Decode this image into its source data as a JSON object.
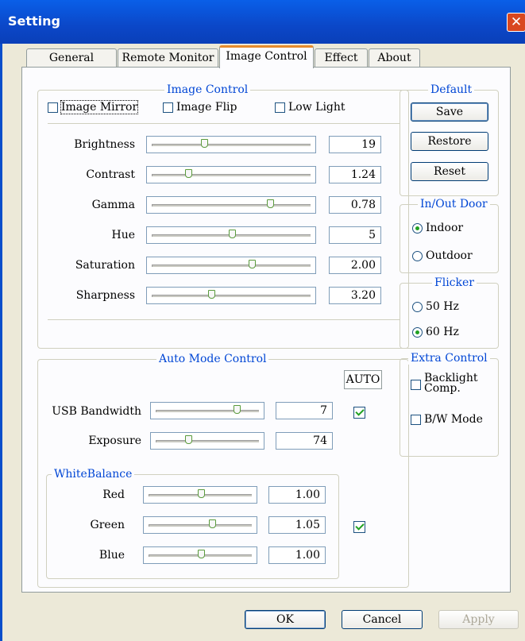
{
  "window": {
    "title": "Setting",
    "close_glyph": "✕"
  },
  "tabs": [
    "General Setting",
    "Remote Monitor",
    "Image Control",
    "Effect",
    "About"
  ],
  "image_control": {
    "title": "Image Control",
    "checkboxes": [
      "Image Mirror",
      "Image Flip",
      "Low Light"
    ],
    "sliders": [
      {
        "label": "Brightness",
        "value": "19",
        "position": 0.32
      },
      {
        "label": "Contrast",
        "value": "1.24",
        "position": 0.22
      },
      {
        "label": "Gamma",
        "value": "0.78",
        "position": 0.75
      },
      {
        "label": "Hue",
        "value": "5",
        "position": 0.5
      },
      {
        "label": "Saturation",
        "value": "2.00",
        "position": 0.63
      },
      {
        "label": "Sharpness",
        "value": "3.20",
        "position": 0.37
      }
    ]
  },
  "auto_mode": {
    "title": "Auto Mode Control",
    "auto_label": "AUTO",
    "usb_bandwidth": {
      "label": "USB Bandwidth",
      "value": "7",
      "position": 0.8,
      "auto_checked": true
    },
    "exposure": {
      "label": "Exposure",
      "value": "74",
      "position": 0.3
    },
    "whitebalance": {
      "title": "WhiteBalance",
      "auto_checked": true,
      "channels": [
        {
          "label": "Red",
          "value": "1.00",
          "position": 0.5
        },
        {
          "label": "Green",
          "value": "1.05",
          "position": 0.62
        },
        {
          "label": "Blue",
          "value": "1.00",
          "position": 0.5
        }
      ]
    }
  },
  "default_group": {
    "title": "Default",
    "buttons": [
      "Save",
      "Restore",
      "Reset"
    ]
  },
  "inout_group": {
    "title": "In/Out Door",
    "options": [
      "Indoor",
      "Outdoor"
    ],
    "selected": "Indoor"
  },
  "flicker_group": {
    "title": "Flicker",
    "options": [
      "50 Hz",
      "60 Hz"
    ],
    "selected": "60 Hz"
  },
  "extra_group": {
    "title": "Extra Control",
    "options": [
      "Backlight Comp.",
      "B/W Mode"
    ]
  },
  "footer": {
    "ok": "OK",
    "cancel": "Cancel",
    "apply": "Apply"
  }
}
